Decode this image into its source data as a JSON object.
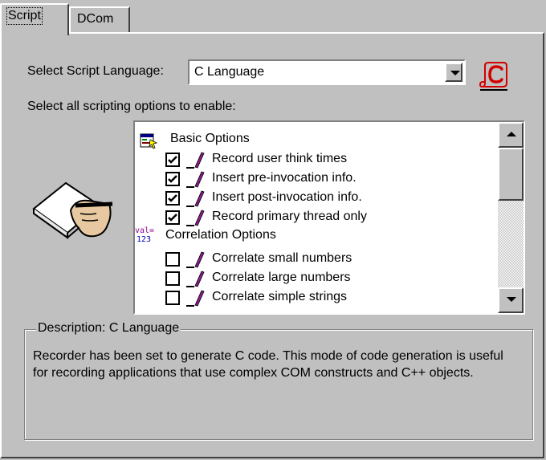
{
  "tabs": [
    {
      "label": "Script",
      "active": true
    },
    {
      "label": "DCom",
      "active": false
    }
  ],
  "script_language": {
    "label": "Select Script Language:",
    "selected": "C Language"
  },
  "options_prompt": "Select all scripting options to enable:",
  "options": {
    "groups": [
      {
        "label": "Basic Options",
        "icon": "basic-options-icon",
        "items": [
          {
            "label": "Record user think times",
            "checked": true
          },
          {
            "label": "Insert pre-invocation info.",
            "checked": true
          },
          {
            "label": "Insert post-invocation info.",
            "checked": true
          },
          {
            "label": "Record primary thread only",
            "checked": true
          }
        ]
      },
      {
        "label": "Correlation Options",
        "icon": "correlation-options-icon",
        "icon_text": [
          "val=",
          "123"
        ],
        "items": [
          {
            "label": "Correlate small numbers",
            "checked": false
          },
          {
            "label": "Correlate large numbers",
            "checked": false
          },
          {
            "label": "Correlate simple strings",
            "checked": false
          }
        ]
      }
    ]
  },
  "description": {
    "title": "Description: C Language",
    "text": "Recorder has been set to generate C code.  This mode of code generation is useful for recording applications that use complex COM constructs and C++ objects."
  },
  "colors": {
    "face": "#c0c0c0",
    "pen": "#8b1a8b",
    "icon_red": "#d40000"
  }
}
